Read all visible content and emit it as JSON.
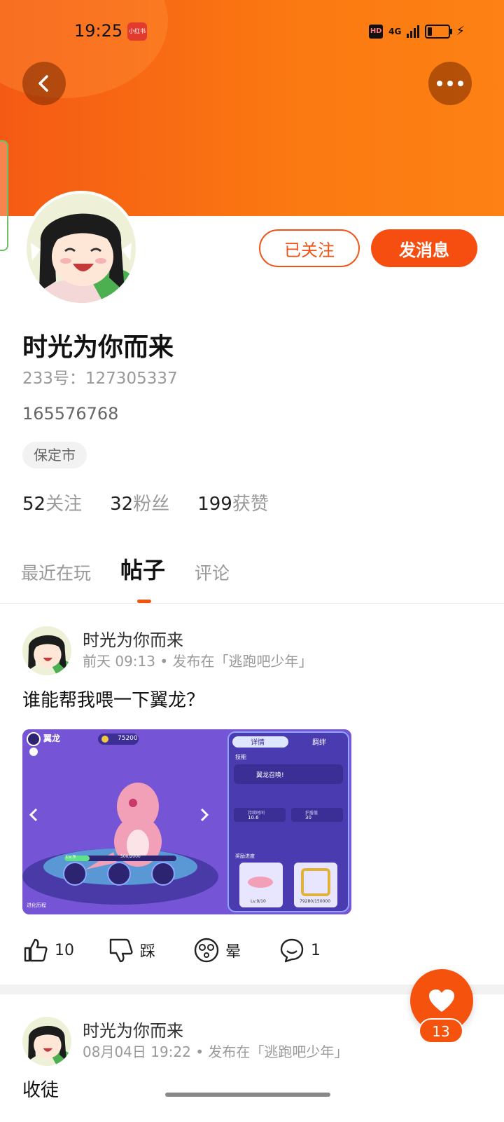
{
  "status_bar": {
    "time": "19:25",
    "app_badge": "小红书",
    "hd": "HD",
    "signal": "4G"
  },
  "profile": {
    "name": "时光为你而来",
    "uid_label": "233号：",
    "uid": "127305337",
    "bio": "165576768",
    "location": "保定市",
    "follow_label": "已关注",
    "message_label": "发消息",
    "stats": [
      {
        "num": "52",
        "label": "关注"
      },
      {
        "num": "32",
        "label": "粉丝"
      },
      {
        "num": "199",
        "label": "获赞"
      }
    ]
  },
  "tabs": [
    "最近在玩",
    "帖子",
    "评论"
  ],
  "posts": [
    {
      "author": "时光为你而来",
      "meta": "前天 09:13 • 发布在「逃跑吧少年」",
      "text": "谁能帮我喂一下翼龙？",
      "image": {
        "title": "翼龙",
        "coins": "75200",
        "tab_detail": "详情",
        "tab_bond": "羁绊",
        "skill_label": "技能",
        "skill_name": "翼龙召唤!",
        "duration_label": "持续时间",
        "duration_value": "10.6",
        "shield_label": "护盾值",
        "shield_value": "30",
        "level": "Lv.9",
        "exp": "500/2000",
        "reward_label": "奖励进度",
        "reward_level": "Lv.9/10",
        "reward_coins": "79280/150000",
        "evolve_label": "进化历程"
      },
      "actions": {
        "like": "10",
        "dislike": "踩",
        "dizzy": "晕",
        "comment": "1"
      }
    },
    {
      "author": "时光为你而来",
      "meta": "08月04日 19:22 • 发布在「逃跑吧少年」",
      "text": "收徒"
    }
  ],
  "fab": {
    "count": "13"
  },
  "colors": {
    "accent": "#f5520e",
    "banner": "#fb7a12"
  }
}
